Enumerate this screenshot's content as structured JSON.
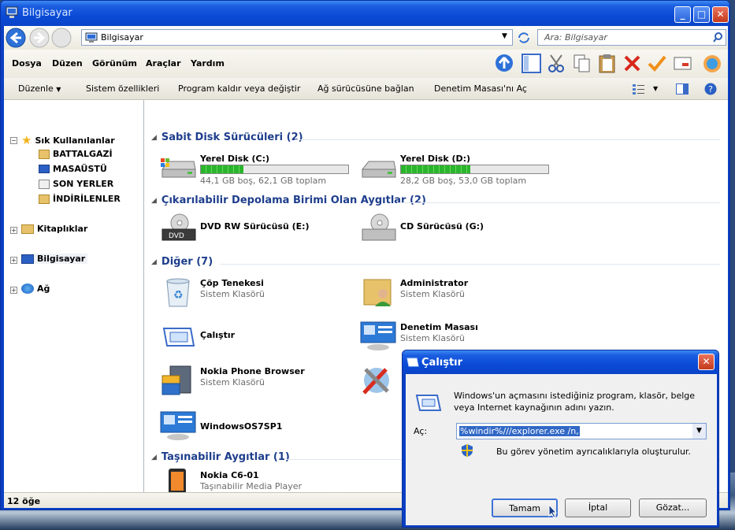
{
  "window": {
    "title": "Bilgisayar"
  },
  "address": {
    "path": "Bilgisayar",
    "search_placeholder": "Ara: Bilgisayar"
  },
  "menu": [
    "Dosya",
    "Düzen",
    "Görünüm",
    "Araçlar",
    "Yardım"
  ],
  "commands": {
    "organize": "Düzenle",
    "system": "Sistem özellikleri",
    "uninstall": "Program kaldır veya değiştir",
    "map_drive": "Ağ sürücüsüne bağlan",
    "control_panel": "Denetim Masası'nı Aç"
  },
  "nav": {
    "favorites": "Sık Kullanılanlar",
    "fav_items": [
      "BATTALGAZİ",
      "MASAÜSTÜ",
      "SON YERLER",
      "İNDİRİLENLER"
    ],
    "libraries": "Kitaplıklar",
    "computer": "Bilgisayar",
    "network": "Ağ"
  },
  "groups": {
    "hdd": "Sabit Disk Sürücüleri (2)",
    "removable": "Çıkarılabilir Depolama Birimi Olan Aygıtlar (2)",
    "other": "Diğer (7)",
    "portable": "Taşınabilir Aygıtlar (1)"
  },
  "drives": [
    {
      "name": "Yerel Disk (C:)",
      "info": "44,1 GB boş, 62,1 GB toplam",
      "used_fraction": 0.29
    },
    {
      "name": "Yerel Disk (D:)",
      "info": "28,2 GB boş, 53,0 GB toplam",
      "used_fraction": 0.47
    }
  ],
  "removables": [
    {
      "name": "DVD RW Sürücüsü (E:)",
      "badge": "DVD"
    },
    {
      "name": "CD Sürücüsü (G:)"
    }
  ],
  "others": [
    {
      "name": "Çöp Tenekesi",
      "sub": "Sistem Klasörü"
    },
    {
      "name": "Administrator",
      "sub": "Sistem Klasörü"
    },
    {
      "name": "Çalıştır",
      "sub": ""
    },
    {
      "name": "Denetim Masası",
      "sub": "Sistem Klasörü"
    },
    {
      "name": "Nokia Phone Browser",
      "sub": "Sistem Klasörü"
    },
    {
      "name": "WindowsOS7SP1",
      "sub": ""
    }
  ],
  "portable": [
    {
      "name": "Nokia C6-01",
      "sub": "Taşınabilir Media Player"
    }
  ],
  "status": "12 öğe",
  "run_dialog": {
    "title": "Çalıştır",
    "description": "Windows'un açmasını istediğiniz program, klasör, belge veya Internet kaynağının adını yazın.",
    "open_label": "Aç:",
    "input_value": "%windir%///explorer.exe /n,",
    "admin_note": "Bu görev yönetim ayrıcalıklarıyla oluşturulur.",
    "ok": "Tamam",
    "cancel": "İptal",
    "browse": "Gözat..."
  }
}
